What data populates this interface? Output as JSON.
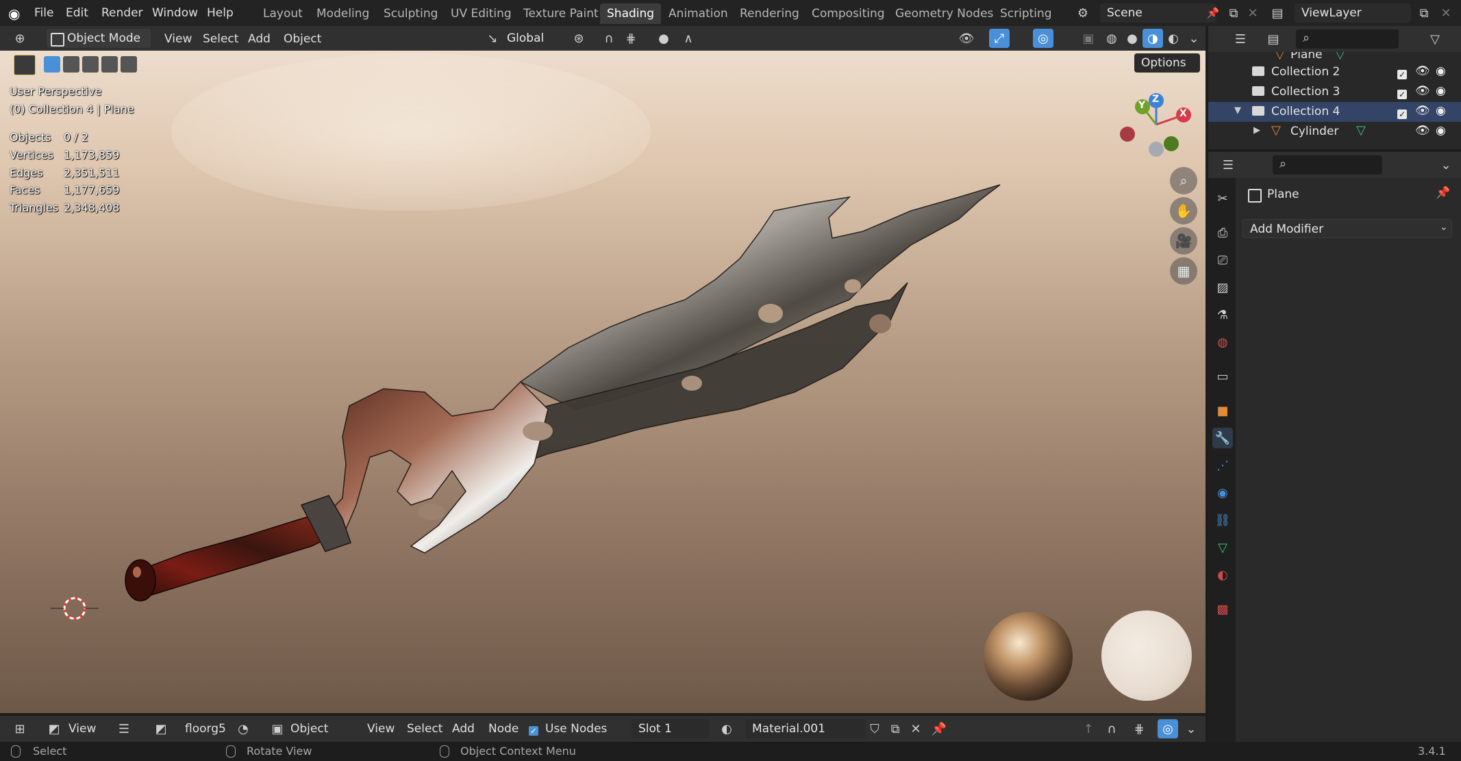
{
  "menu": {
    "items": [
      "File",
      "Edit",
      "Render",
      "Window",
      "Help"
    ],
    "workspaces": [
      "Layout",
      "Modeling",
      "Sculpting",
      "UV Editing",
      "Texture Paint",
      "Shading",
      "Animation",
      "Rendering",
      "Compositing",
      "Geometry Nodes",
      "Scripting"
    ],
    "active_workspace": "Shading",
    "scene": "Scene",
    "view_layer": "ViewLayer"
  },
  "viewport_header": {
    "mode": "Object Mode",
    "menus": [
      "View",
      "Select",
      "Add",
      "Object"
    ],
    "transform_orientation": "Global",
    "options_label": "Options"
  },
  "viewport_overlay": {
    "perspective": "User Perspective",
    "context": "(0) Collection 4 | Plane",
    "stats": [
      {
        "label": "Objects",
        "value": "0 / 2"
      },
      {
        "label": "Vertices",
        "value": "1,173,859"
      },
      {
        "label": "Edges",
        "value": "2,351,511"
      },
      {
        "label": "Faces",
        "value": "1,177,659"
      },
      {
        "label": "Triangles",
        "value": "2,348,408"
      }
    ],
    "gizmo_axes": [
      "X",
      "Y",
      "Z"
    ]
  },
  "node_header": {
    "view_label": "View",
    "world_name": "floorg5",
    "object_type": "Object",
    "menus": [
      "View",
      "Select",
      "Add",
      "Node"
    ],
    "use_nodes_label": "Use Nodes",
    "use_nodes_checked": true,
    "slot": "Slot 1",
    "material": "Material.001"
  },
  "statusbar": {
    "left_action": "Select",
    "middle_action": "Rotate View",
    "right_action": "Object Context Menu",
    "version": "3.4.1"
  },
  "outliner": {
    "rows": [
      {
        "label": "Plane",
        "type": "mesh"
      },
      {
        "label": "Collection 2",
        "type": "collection"
      },
      {
        "label": "Collection 3",
        "type": "collection"
      },
      {
        "label": "Collection 4",
        "type": "collection"
      },
      {
        "label": "Cylinder",
        "type": "mesh"
      }
    ]
  },
  "properties": {
    "object_name": "Plane",
    "add_modifier_label": "Add Modifier"
  },
  "colors": {
    "accent": "#4a90d9",
    "active_tab": "#3c3c3c",
    "axis_x": "#d63a4a",
    "axis_y": "#6fa02a",
    "axis_z": "#3d82d6"
  }
}
